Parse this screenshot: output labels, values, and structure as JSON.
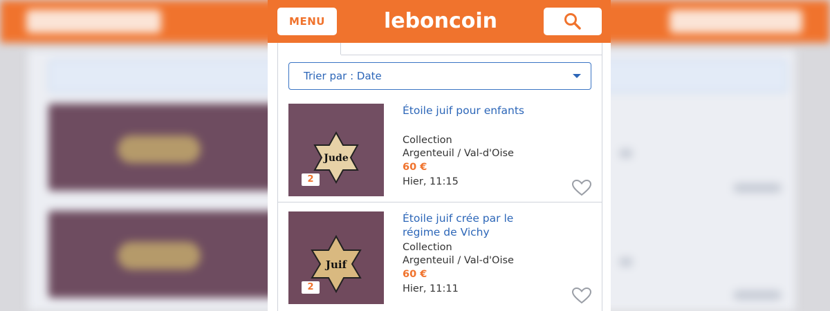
{
  "colors": {
    "brand": "#f0732d",
    "link": "#2c66b8",
    "text": "#333333"
  },
  "header": {
    "menu_label": "MENU",
    "logo_text": "leboncoin",
    "search_icon": "search-icon"
  },
  "sort": {
    "label": "Trier par : Date"
  },
  "listings": [
    {
      "title": "Étoile juif pour enfants",
      "category": "Collection",
      "location": "Argenteuil / Val-d'Oise",
      "price": "60 €",
      "date": "Hier, 11:15",
      "photo_count": "2",
      "star_text": "Jude"
    },
    {
      "title": "Étoile juif crée par le régime de Vichy",
      "category": "Collection",
      "location": "Argenteuil / Val-d'Oise",
      "price": "60 €",
      "date": "Hier, 11:11",
      "photo_count": "2",
      "star_text": "Juif"
    }
  ]
}
